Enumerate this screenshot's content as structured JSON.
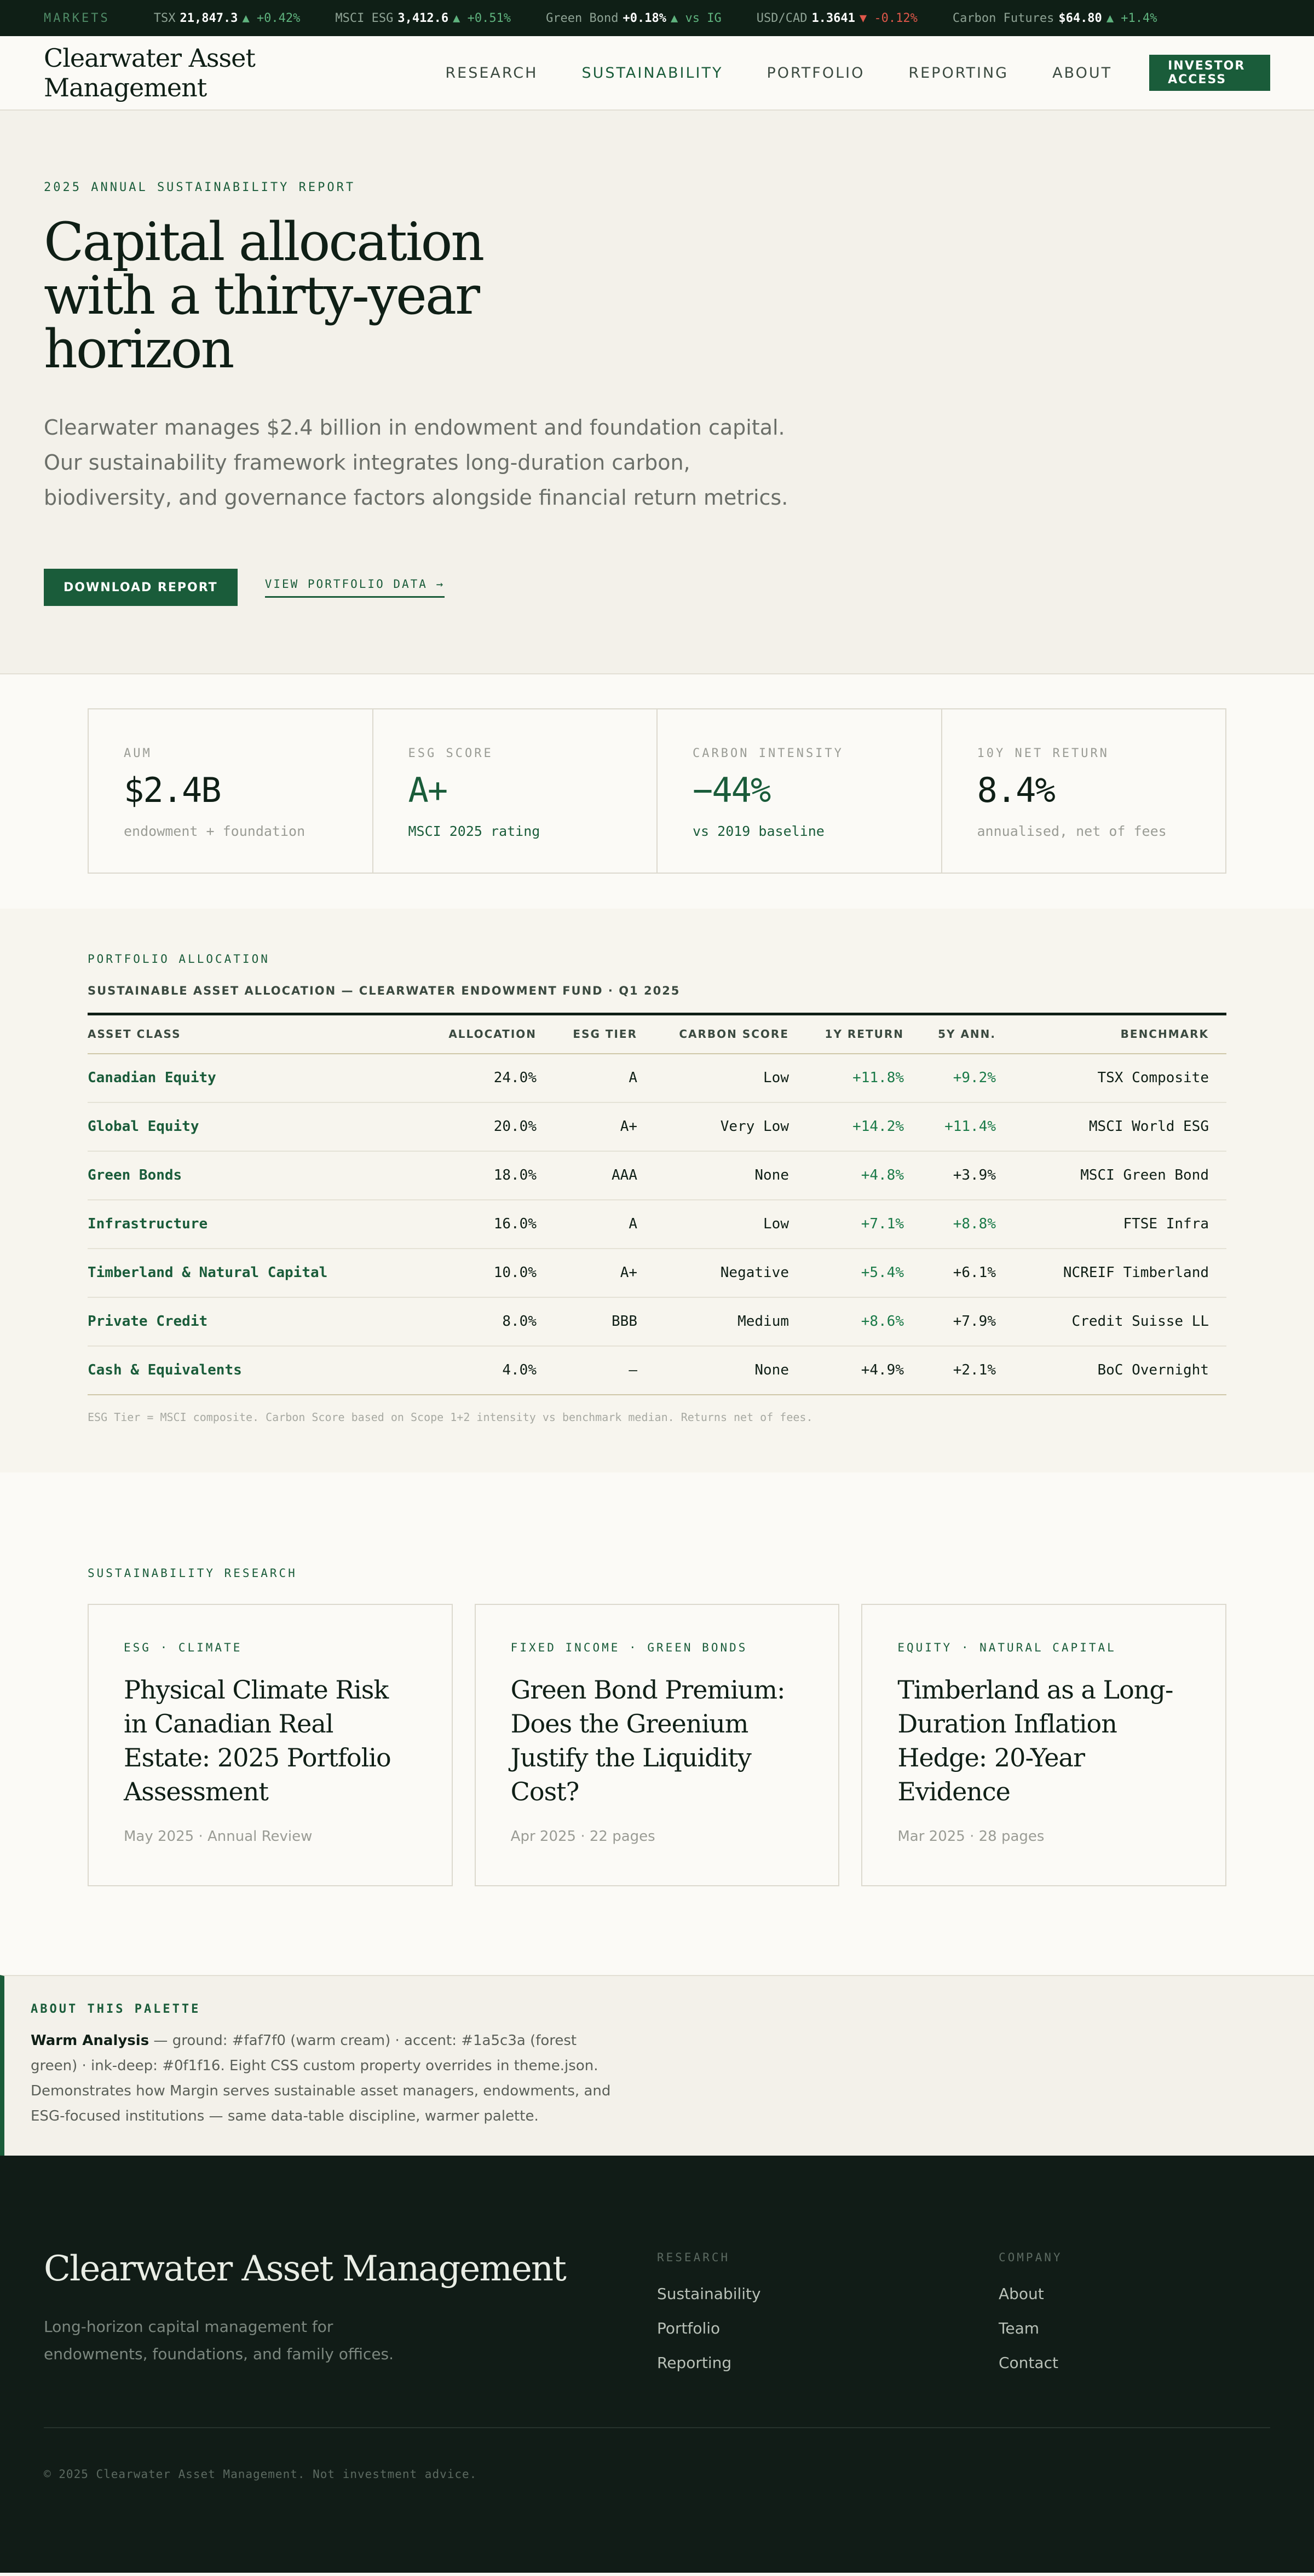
{
  "ticker": {
    "label": "MARKETS",
    "items": [
      {
        "name": "TSX",
        "value": "21,847.3",
        "change": "▲ +0.42%",
        "dir": "up"
      },
      {
        "name": "MSCI ESG",
        "value": "3,412.6",
        "change": "▲ +0.51%",
        "dir": "up"
      },
      {
        "name": "Green Bond",
        "value": "+0.18%",
        "change": "▲ vs IG",
        "dir": "up"
      },
      {
        "name": "USD/CAD",
        "value": "1.3641",
        "change": "▼ -0.12%",
        "dir": "down"
      },
      {
        "name": "Carbon Futures",
        "value": "$64.80",
        "change": "▲ +1.4%",
        "dir": "up"
      }
    ]
  },
  "header": {
    "brand": "Clearwater Asset Management",
    "nav": [
      "RESEARCH",
      "SUSTAINABILITY",
      "PORTFOLIO",
      "REPORTING",
      "ABOUT"
    ],
    "active_nav": "SUSTAINABILITY",
    "cta": "INVESTOR ACCESS"
  },
  "hero": {
    "eyebrow": "2025 ANNUAL SUSTAINABILITY REPORT",
    "title": "Capital allocation with a thirty-year horizon",
    "lead": "Clearwater manages $2.4 billion in endowment and foundation capital. Our sustainability framework integrates long-duration carbon, biodiversity, and governance factors alongside financial return metrics.",
    "primary_cta": "DOWNLOAD REPORT",
    "secondary_cta": "VIEW PORTFOLIO DATA →"
  },
  "stats": [
    {
      "label": "AUM",
      "value": "$2.4B",
      "sub": "endowment + foundation",
      "accent": false
    },
    {
      "label": "ESG SCORE",
      "value": "A+",
      "sub": "MSCI 2025 rating",
      "accent": true
    },
    {
      "label": "CARBON INTENSITY",
      "value": "−44%",
      "sub": "vs 2019 baseline",
      "accent": true
    },
    {
      "label": "10Y NET RETURN",
      "value": "8.4%",
      "sub": "annualised, net of fees",
      "accent": false
    }
  ],
  "allocation": {
    "eyebrow": "PORTFOLIO ALLOCATION",
    "subtitle": "SUSTAINABLE ASSET ALLOCATION — CLEARWATER ENDOWMENT FUND · Q1 2025",
    "columns": [
      "ASSET CLASS",
      "ALLOCATION",
      "ESG TIER",
      "CARBON SCORE",
      "1Y RETURN",
      "5Y ANN.",
      "BENCHMARK"
    ],
    "rows": [
      [
        "Canadian Equity",
        "24.0%",
        "A",
        "Low",
        "+11.8%",
        "+9.2%",
        "TSX Composite"
      ],
      [
        "Global Equity",
        "20.0%",
        "A+",
        "Very Low",
        "+14.2%",
        "+11.4%",
        "MSCI World ESG"
      ],
      [
        "Green Bonds",
        "18.0%",
        "AAA",
        "None",
        "+4.8%",
        "+3.9%",
        "MSCI Green Bond"
      ],
      [
        "Infrastructure",
        "16.0%",
        "A",
        "Low",
        "+7.1%",
        "+8.8%",
        "FTSE Infra"
      ],
      [
        "Timberland & Natural Capital",
        "10.0%",
        "A+",
        "Negative",
        "+5.4%",
        "+6.1%",
        "NCREIF Timberland"
      ],
      [
        "Private Credit",
        "8.0%",
        "BBB",
        "Medium",
        "+8.6%",
        "+7.9%",
        "Credit Suisse LL"
      ],
      [
        "Cash & Equivalents",
        "4.0%",
        "—",
        "None",
        "+4.9%",
        "+2.1%",
        "BoC Overnight"
      ]
    ],
    "note": "ESG Tier = MSCI composite. Carbon Score based on Scope 1+2 intensity vs benchmark median. Returns net of fees."
  },
  "research": {
    "eyebrow": "SUSTAINABILITY RESEARCH",
    "cards": [
      {
        "tag": "ESG · CLIMATE",
        "title": "Physical Climate Risk in Canadian Real Estate: 2025 Portfolio Assessment",
        "meta": "May 2025 · Annual Review"
      },
      {
        "tag": "FIXED INCOME · GREEN BONDS",
        "title": "Green Bond Premium: Does the Greenium Justify the Liquidity Cost?",
        "meta": "Apr 2025 · 22 pages"
      },
      {
        "tag": "EQUITY · NATURAL CAPITAL",
        "title": "Timberland as a Long-Duration Inflation Hedge: 20-Year Evidence",
        "meta": "Mar 2025 · 28 pages"
      }
    ]
  },
  "palette": {
    "eyebrow": "ABOUT THIS PALETTE",
    "name": "Warm Analysis",
    "text": " — ground: #faf7f0 (warm cream) · accent: #1a5c3a (forest green) · ink-deep: #0f1f16. Eight CSS custom property overrides in theme.json. Demonstrates how Margin serves sustainable asset managers, endowments, and ESG-focused institutions — same data-table discipline, warmer palette."
  },
  "footer": {
    "brand": "Clearwater Asset Management",
    "tagline": "Long-horizon capital management for endowments, foundations, and family offices.",
    "research_heading": "RESEARCH",
    "research_links": [
      "Sustainability",
      "Portfolio",
      "Reporting"
    ],
    "company_heading": "COMPANY",
    "company_links": [
      "About",
      "Team",
      "Contact"
    ],
    "copyright": "© 2025 Clearwater Asset Management. Not investment advice."
  },
  "colors": {
    "ground": "#faf7f0",
    "accent": "#1a5c3a",
    "ink_deep": "#0f1f16",
    "up": "#5fb37e",
    "down": "#e0574a"
  }
}
